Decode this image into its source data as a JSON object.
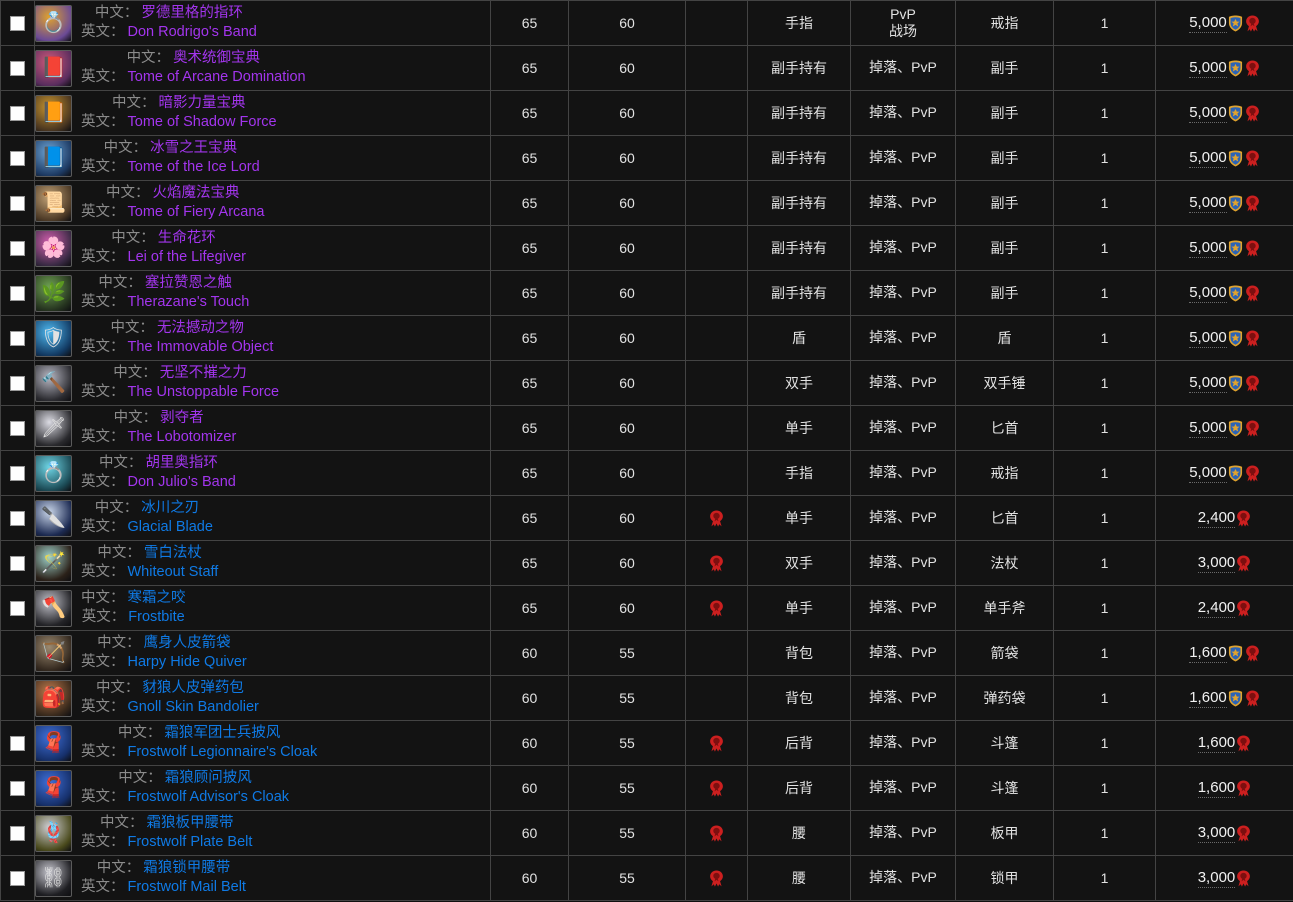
{
  "table": {
    "columns": [
      {
        "key": "select",
        "label": "",
        "name": "select-column"
      },
      {
        "key": "name",
        "label": "",
        "name": "item-name-column"
      },
      {
        "key": "ilvl",
        "label": "",
        "name": "item-level-column"
      },
      {
        "key": "reqlvl",
        "label": "",
        "name": "required-level-column"
      },
      {
        "key": "faction",
        "label": "",
        "name": "faction-column"
      },
      {
        "key": "slot",
        "label": "",
        "name": "equip-slot-column"
      },
      {
        "key": "source",
        "label": "",
        "name": "source-column"
      },
      {
        "key": "type",
        "label": "",
        "name": "item-type-column"
      },
      {
        "key": "count",
        "label": "",
        "name": "count-column"
      },
      {
        "key": "price",
        "label": "",
        "name": "price-column"
      }
    ],
    "labels": {
      "cn": "中文：",
      "en": "英文："
    },
    "rows": [
      {
        "checkbox": true,
        "quality": "epic",
        "icon": "ring-gold-icon",
        "icon_glyph": "💍",
        "icon_colors": [
          "#6b4a96",
          "#e0a32e"
        ],
        "cn": "罗德里格的指环",
        "en": "Don Rodrigo's Band",
        "ilvl": "65",
        "reqlvl": "60",
        "faction": [],
        "slot": "手指",
        "source": "PvP\n战场",
        "source_lines": [
          "PvP",
          "战场"
        ],
        "type": "戒指",
        "count": "1",
        "price": "5,000",
        "price_factions": [
          "alliance",
          "horde"
        ]
      },
      {
        "checkbox": true,
        "quality": "epic",
        "icon": "tome-pink-icon",
        "icon_glyph": "📕",
        "icon_colors": [
          "#5a2d5e",
          "#d05a7a"
        ],
        "cn": "奥术统御宝典",
        "en": "Tome of Arcane Domination",
        "ilvl": "65",
        "reqlvl": "60",
        "faction": [],
        "slot": "副手持有",
        "source": "掉落、PvP",
        "source_lines": [
          "掉落、PvP"
        ],
        "type": "副手",
        "count": "1",
        "price": "5,000",
        "price_factions": [
          "alliance",
          "horde"
        ]
      },
      {
        "checkbox": true,
        "quality": "epic",
        "icon": "tome-gold-icon",
        "icon_glyph": "📙",
        "icon_colors": [
          "#4a3620",
          "#c9962f"
        ],
        "cn": "暗影力量宝典",
        "en": "Tome of Shadow Force",
        "ilvl": "65",
        "reqlvl": "60",
        "faction": [],
        "slot": "副手持有",
        "source": "掉落、PvP",
        "source_lines": [
          "掉落、PvP"
        ],
        "type": "副手",
        "count": "1",
        "price": "5,000",
        "price_factions": [
          "alliance",
          "horde"
        ]
      },
      {
        "checkbox": true,
        "quality": "epic",
        "icon": "tome-blue-icon",
        "icon_glyph": "📘",
        "icon_colors": [
          "#1d3a63",
          "#6fa7d8"
        ],
        "cn": "冰雪之王宝典",
        "en": "Tome of the Ice Lord",
        "ilvl": "65",
        "reqlvl": "60",
        "faction": [],
        "slot": "副手持有",
        "source": "掉落、PvP",
        "source_lines": [
          "掉落、PvP"
        ],
        "type": "副手",
        "count": "1",
        "price": "5,000",
        "price_factions": [
          "alliance",
          "horde"
        ]
      },
      {
        "checkbox": true,
        "quality": "epic",
        "icon": "tome-brown-icon",
        "icon_glyph": "📜",
        "icon_colors": [
          "#4d3a26",
          "#c2a276"
        ],
        "cn": "火焰魔法宝典",
        "en": "Tome of Fiery Arcana",
        "ilvl": "65",
        "reqlvl": "60",
        "faction": [],
        "slot": "副手持有",
        "source": "掉落、PvP",
        "source_lines": [
          "掉落、PvP"
        ],
        "type": "副手",
        "count": "1",
        "price": "5,000",
        "price_factions": [
          "alliance",
          "horde"
        ]
      },
      {
        "checkbox": true,
        "quality": "epic",
        "icon": "flower-lei-icon",
        "icon_glyph": "🌸",
        "icon_colors": [
          "#3a2a44",
          "#d25fae"
        ],
        "cn": "生命花环",
        "en": "Lei of the Lifegiver",
        "ilvl": "65",
        "reqlvl": "60",
        "faction": [],
        "slot": "副手持有",
        "source": "掉落、PvP",
        "source_lines": [
          "掉落、PvP"
        ],
        "type": "副手",
        "count": "1",
        "price": "5,000",
        "price_factions": [
          "alliance",
          "horde"
        ]
      },
      {
        "checkbox": true,
        "quality": "epic",
        "icon": "branch-touch-icon",
        "icon_glyph": "🌿",
        "icon_colors": [
          "#25331f",
          "#6fa352"
        ],
        "cn": "塞拉赞恩之触",
        "en": "Therazane's Touch",
        "ilvl": "65",
        "reqlvl": "60",
        "faction": [],
        "slot": "副手持有",
        "source": "掉落、PvP",
        "source_lines": [
          "掉落、PvP"
        ],
        "type": "副手",
        "count": "1",
        "price": "5,000",
        "price_factions": [
          "alliance",
          "horde"
        ]
      },
      {
        "checkbox": true,
        "quality": "epic",
        "icon": "shield-blue-icon",
        "icon_glyph": "🛡",
        "icon_colors": [
          "#123a63",
          "#4fb9f0"
        ],
        "cn": "无法撼动之物",
        "en": "The Immovable Object",
        "ilvl": "65",
        "reqlvl": "60",
        "faction": [],
        "slot": "盾",
        "source": "掉落、PvP",
        "source_lines": [
          "掉落、PvP"
        ],
        "type": "盾",
        "count": "1",
        "price": "5,000",
        "price_factions": [
          "alliance",
          "horde"
        ]
      },
      {
        "checkbox": true,
        "quality": "epic",
        "icon": "two-hand-mace-icon",
        "icon_glyph": "🔨",
        "icon_colors": [
          "#2b2b30",
          "#b9b9c4"
        ],
        "cn": "无坚不摧之力",
        "en": "The Unstoppable Force",
        "ilvl": "65",
        "reqlvl": "60",
        "faction": [],
        "slot": "双手",
        "source": "掉落、PvP",
        "source_lines": [
          "掉落、PvP"
        ],
        "type": "双手锤",
        "count": "1",
        "price": "5,000",
        "price_factions": [
          "alliance",
          "horde"
        ]
      },
      {
        "checkbox": true,
        "quality": "epic",
        "icon": "dagger-white-icon",
        "icon_glyph": "🗡",
        "icon_colors": [
          "#2a2a2e",
          "#dcdce4"
        ],
        "cn": "剥夺者",
        "en": "The Lobotomizer",
        "ilvl": "65",
        "reqlvl": "60",
        "faction": [],
        "slot": "单手",
        "source": "掉落、PvP",
        "source_lines": [
          "掉落、PvP"
        ],
        "type": "匕首",
        "count": "1",
        "price": "5,000",
        "price_factions": [
          "alliance",
          "horde"
        ]
      },
      {
        "checkbox": true,
        "quality": "epic",
        "icon": "ring-teal-icon",
        "icon_glyph": "💍",
        "icon_colors": [
          "#1b4a55",
          "#6fd6e6"
        ],
        "cn": "胡里奥指环",
        "en": "Don Julio's Band",
        "ilvl": "65",
        "reqlvl": "60",
        "faction": [],
        "slot": "手指",
        "source": "掉落、PvP",
        "source_lines": [
          "掉落、PvP"
        ],
        "type": "戒指",
        "count": "1",
        "price": "5,000",
        "price_factions": [
          "alliance",
          "horde"
        ]
      },
      {
        "checkbox": true,
        "quality": "rare",
        "icon": "glacial-blade-icon",
        "icon_glyph": "🔪",
        "icon_colors": [
          "#1c2a52",
          "#c9d6ea"
        ],
        "cn": "冰川之刃",
        "en": "Glacial Blade",
        "ilvl": "65",
        "reqlvl": "60",
        "faction": [
          "horde"
        ],
        "slot": "单手",
        "source": "掉落、PvP",
        "source_lines": [
          "掉落、PvP"
        ],
        "type": "匕首",
        "count": "1",
        "price": "2,400",
        "price_factions": [
          "horde"
        ]
      },
      {
        "checkbox": true,
        "quality": "rare",
        "icon": "whiteout-staff-icon",
        "icon_glyph": "🪄",
        "icon_colors": [
          "#2b2119",
          "#9fd2cb"
        ],
        "cn": "雪白法杖",
        "en": "Whiteout Staff",
        "ilvl": "65",
        "reqlvl": "60",
        "faction": [
          "horde"
        ],
        "slot": "双手",
        "source": "掉落、PvP",
        "source_lines": [
          "掉落、PvP"
        ],
        "type": "法杖",
        "count": "1",
        "price": "3,000",
        "price_factions": [
          "horde"
        ]
      },
      {
        "checkbox": true,
        "quality": "rare",
        "icon": "frostbite-axe-icon",
        "icon_glyph": "🪓",
        "icon_colors": [
          "#242428",
          "#c3c3cb"
        ],
        "cn": "寒霜之咬",
        "en": "Frostbite",
        "ilvl": "65",
        "reqlvl": "60",
        "faction": [
          "horde"
        ],
        "slot": "单手",
        "source": "掉落、PvP",
        "source_lines": [
          "掉落、PvP"
        ],
        "type": "单手斧",
        "count": "1",
        "price": "2,400",
        "price_factions": [
          "horde"
        ]
      },
      {
        "checkbox": false,
        "quality": "rare",
        "icon": "harpy-quiver-icon",
        "icon_glyph": "🏹",
        "icon_colors": [
          "#33281e",
          "#9c8a70"
        ],
        "cn": "鹰身人皮箭袋",
        "en": "Harpy Hide Quiver",
        "ilvl": "60",
        "reqlvl": "55",
        "faction": [],
        "slot": "背包",
        "source": "掉落、PvP",
        "source_lines": [
          "掉落、PvP"
        ],
        "type": "箭袋",
        "count": "1",
        "price": "1,600",
        "price_factions": [
          "alliance",
          "horde"
        ]
      },
      {
        "checkbox": false,
        "quality": "rare",
        "icon": "gnoll-bandolier-icon",
        "icon_glyph": "🎒",
        "icon_colors": [
          "#3a2a1c",
          "#c07a4c"
        ],
        "cn": "豺狼人皮弹药包",
        "en": "Gnoll Skin Bandolier",
        "ilvl": "60",
        "reqlvl": "55",
        "faction": [],
        "slot": "背包",
        "source": "掉落、PvP",
        "source_lines": [
          "掉落、PvP"
        ],
        "type": "弹药袋",
        "count": "1",
        "price": "1,600",
        "price_factions": [
          "alliance",
          "horde"
        ]
      },
      {
        "checkbox": true,
        "quality": "rare",
        "icon": "cloak-blue-icon",
        "icon_glyph": "🧣",
        "icon_colors": [
          "#16306b",
          "#3f6fd8"
        ],
        "cn": "霜狼军团士兵披风",
        "en": "Frostwolf Legionnaire's Cloak",
        "ilvl": "60",
        "reqlvl": "55",
        "faction": [
          "horde"
        ],
        "slot": "后背",
        "source": "掉落、PvP",
        "source_lines": [
          "掉落、PvP"
        ],
        "type": "斗篷",
        "count": "1",
        "price": "1,600",
        "price_factions": [
          "horde"
        ]
      },
      {
        "checkbox": true,
        "quality": "rare",
        "icon": "cloak-blue-icon",
        "icon_glyph": "🧣",
        "icon_colors": [
          "#16306b",
          "#3f6fd8"
        ],
        "cn": "霜狼顾问披风",
        "en": "Frostwolf Advisor's Cloak",
        "ilvl": "60",
        "reqlvl": "55",
        "faction": [
          "horde"
        ],
        "slot": "后背",
        "source": "掉落、PvP",
        "source_lines": [
          "掉落、PvP"
        ],
        "type": "斗篷",
        "count": "1",
        "price": "1,600",
        "price_factions": [
          "horde"
        ]
      },
      {
        "checkbox": true,
        "quality": "rare",
        "icon": "plate-belt-icon",
        "icon_glyph": "🪢",
        "icon_colors": [
          "#4a4a1c",
          "#cfcfd6"
        ],
        "cn": "霜狼板甲腰带",
        "en": "Frostwolf Plate Belt",
        "ilvl": "60",
        "reqlvl": "55",
        "faction": [
          "horde"
        ],
        "slot": "腰",
        "source": "掉落、PvP",
        "source_lines": [
          "掉落、PvP"
        ],
        "type": "板甲",
        "count": "1",
        "price": "3,000",
        "price_factions": [
          "horde"
        ]
      },
      {
        "checkbox": true,
        "quality": "rare",
        "icon": "mail-belt-icon",
        "icon_glyph": "⛓",
        "icon_colors": [
          "#1e1e22",
          "#c7c7cf"
        ],
        "cn": "霜狼锁甲腰带",
        "en": "Frostwolf Mail Belt",
        "ilvl": "60",
        "reqlvl": "55",
        "faction": [
          "horde"
        ],
        "slot": "腰",
        "source": "掉落、PvP",
        "source_lines": [
          "掉落、PvP"
        ],
        "type": "锁甲",
        "count": "1",
        "price": "3,000",
        "price_factions": [
          "horde"
        ]
      }
    ]
  },
  "colors": {
    "epic": "#a335ee",
    "rare": "#0f7ae5",
    "horde": "#cc1f1f",
    "alliance_gold": "#e0a32e",
    "alliance_blue": "#2c63b5",
    "background": "#131313",
    "border": "#444444",
    "label_gray": "#8b8b8b"
  },
  "icons": {
    "horde": "horde-faction-icon",
    "alliance": "alliance-faction-icon",
    "checkbox": "row-checkbox"
  }
}
